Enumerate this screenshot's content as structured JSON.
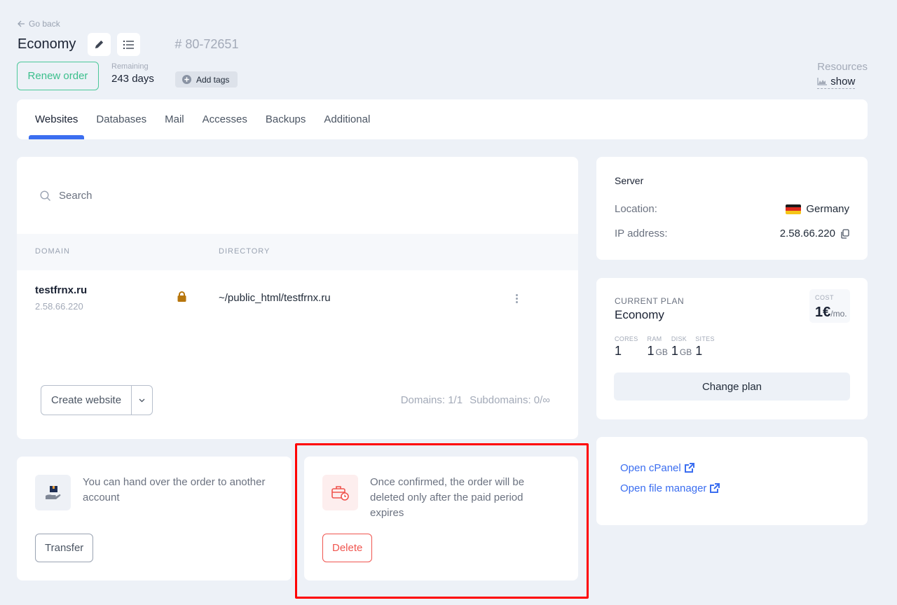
{
  "header": {
    "go_back": "Go back",
    "title": "Economy",
    "order_id": "# 80-72651",
    "renew_label": "Renew order",
    "remaining_label": "Remaining",
    "remaining_value": "243 days",
    "add_tags_label": "Add tags",
    "resources_label": "Resources",
    "resources_show": "show"
  },
  "tabs": [
    {
      "label": "Websites",
      "active": true
    },
    {
      "label": "Databases"
    },
    {
      "label": "Mail"
    },
    {
      "label": "Accesses"
    },
    {
      "label": "Backups"
    },
    {
      "label": "Additional"
    }
  ],
  "websites": {
    "search_placeholder": "Search",
    "columns": [
      "DOMAIN",
      "DIRECTORY"
    ],
    "rows": [
      {
        "domain": "testfrnx.ru",
        "ip": "2.58.66.220",
        "ssl_icon": "lock-icon",
        "directory": "~/public_html/testfrnx.ru"
      }
    ],
    "create_label": "Create website",
    "domains_count": "Domains: 1/1",
    "subdomains_count": "Subdomains: 0/∞"
  },
  "server": {
    "title": "Server",
    "location_label": "Location:",
    "location_value": "Germany",
    "ip_label": "IP address:",
    "ip_value": "2.58.66.220"
  },
  "plan": {
    "label": "CURRENT PLAN",
    "name": "Economy",
    "cost_label": "COST",
    "cost_value": "1€",
    "cost_unit": "/mo.",
    "specs": [
      {
        "label": "CORES",
        "value": "1",
        "unit": ""
      },
      {
        "label": "RAM",
        "value": "1",
        "unit": "GB"
      },
      {
        "label": "DISK",
        "value": "1",
        "unit": "GB"
      },
      {
        "label": "SITES",
        "value": "1",
        "unit": ""
      }
    ],
    "change_label": "Change plan"
  },
  "links": {
    "cpanel": "Open cPanel",
    "file_manager": "Open file manager"
  },
  "transfer": {
    "description": "You can hand over the order to another account",
    "button": "Transfer"
  },
  "delete": {
    "description": "Once confirmed, the order will be deleted only after the paid period expires",
    "button": "Delete"
  },
  "colors": {
    "accent": "#3b6ef0",
    "renew_green": "#3bbf8c",
    "danger": "#f0554f",
    "lock": "#b7760d",
    "annotation": "#ff0000"
  }
}
